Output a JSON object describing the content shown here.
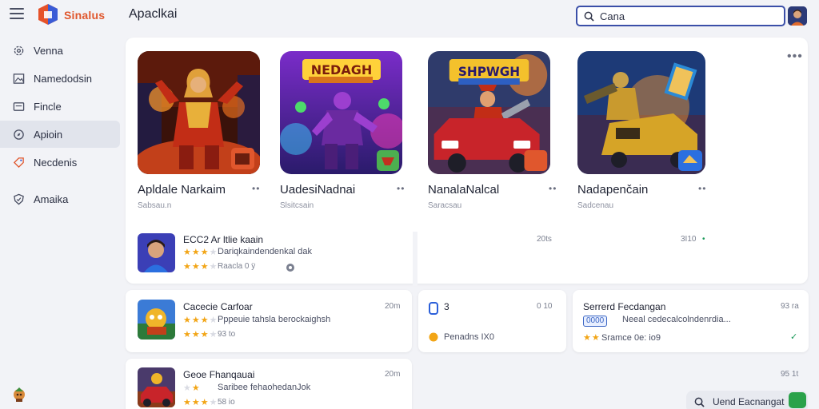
{
  "header": {
    "brand": "Sinalus",
    "app_title": "Apaclkai",
    "search_value": "Cana"
  },
  "sidebar": {
    "items": [
      {
        "label": "Venna",
        "icon": "gear-icon"
      },
      {
        "label": "Namedodsin",
        "icon": "image-icon"
      },
      {
        "label": "Fincle",
        "icon": "folder-icon"
      },
      {
        "label": "Apioin",
        "icon": "compass-icon",
        "active": true
      },
      {
        "label": "Necdenis",
        "icon": "tag-icon"
      },
      {
        "label": "Amaika",
        "icon": "shield-icon"
      }
    ]
  },
  "featured": [
    {
      "name": "Apldale Narkaim",
      "sub": "Sabsau.n"
    },
    {
      "name": "UadesiNadnai",
      "sub": "Slsitcsain"
    },
    {
      "name": "NanalaNalcal",
      "sub": "Saracsau"
    },
    {
      "name": "Nadapenčain",
      "sub": "Sadcenau"
    }
  ],
  "featured_banners": {
    "tile2": "NEDAGH",
    "tile3": "SHPWGH"
  },
  "info_row": {
    "title": "ECC2 Ar ltlie kaain",
    "subtitle": "Dariqkaindendenkal dak",
    "meta_left": "Raacla 0 ÿ",
    "meta_mid": "20ts",
    "meta_right": "3I10",
    "rating": 3
  },
  "list": [
    {
      "title": "Cacecie Carfoar",
      "subtitle": "Pppeuie tahsla berockaighsh",
      "meta": "93 to",
      "time": "20m",
      "rating": 3
    },
    {
      "title": "Geoe Fhanqauai",
      "subtitle": "Saribee fehaohedanJok",
      "meta": "58 io",
      "time": "20m",
      "rating": 3
    }
  ],
  "mid_card": {
    "number": "3",
    "time": "0 10",
    "label": "Penadns IX0"
  },
  "right_card": {
    "title": "Serrerd Fecdangan",
    "chip": "0000",
    "subtitle": "Neeal cedecalcolndenrdia...",
    "meta": "Sramce 0e: io9",
    "time": "93 ra"
  },
  "right_card_2": {
    "time": "95 1t"
  },
  "bottom_search": {
    "label": "Uend Eacnangat"
  },
  "colors": {
    "brand": "#e0572d",
    "accent": "#3b4fa8",
    "active_nav": "#e1e4ec",
    "star": "#f2a516",
    "ok": "#1c9a5a"
  }
}
